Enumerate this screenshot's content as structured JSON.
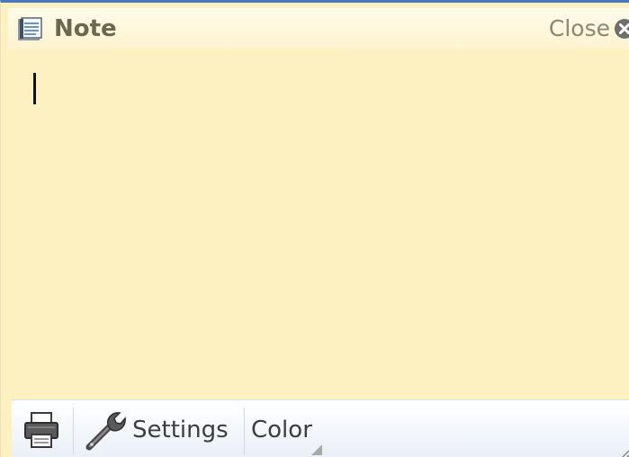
{
  "window": {
    "title": "Note",
    "close_label": "Close",
    "colors": {
      "note_background": "#fdf1c2",
      "top_border": "#4a78bd",
      "toolbar_background": "#e9eef7"
    }
  },
  "note": {
    "text": ""
  },
  "toolbar": {
    "print_icon": "printer-icon",
    "settings_label": "Settings",
    "settings_icon": "wrench-icon",
    "color_label": "Color"
  }
}
